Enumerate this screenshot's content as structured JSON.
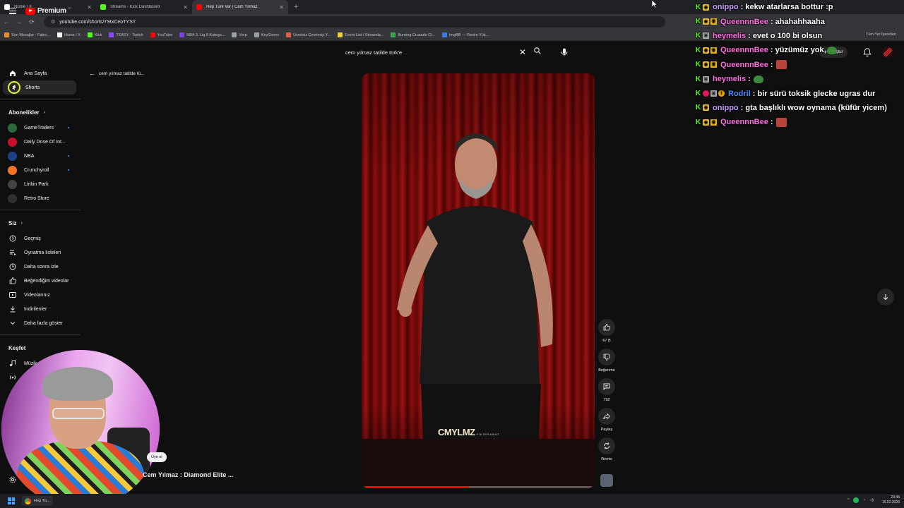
{
  "browser": {
    "tabs": [
      {
        "title": "Home / X",
        "color": "#ffffff"
      },
      {
        "title": "Streams - Kick Dashboard",
        "color": "#53fc18"
      },
      {
        "title": "Hep Türk Var | Cem Yılmaz",
        "color": "#ff0000"
      }
    ],
    "url": "youtube.com/shorts/7StxCeoTYSY",
    "bookmarks": [
      {
        "label": "Son Mesajlar - Fabci...",
        "color": "#f28b30"
      },
      {
        "label": "Home / X",
        "color": "#ffffff"
      },
      {
        "label": "Kick",
        "color": "#53fc18"
      },
      {
        "label": "TEASY - Twitch",
        "color": "#9146ff"
      },
      {
        "label": "YouTube",
        "color": "#ff0000"
      },
      {
        "label": "NBA 3. Lig 8 Katego...",
        "color": "#7b3fe4"
      },
      {
        "label": "Vorp",
        "color": "#9aa0a6"
      },
      {
        "label": "KeyGivers",
        "color": "#9aa0a6"
      },
      {
        "label": "Ücretsiz Çevrimiçi Y...",
        "color": "#e0604a"
      },
      {
        "label": "Event List / Streamla...",
        "color": "#f2d13a"
      },
      {
        "label": "Burning Crusade Cl...",
        "color": "#3da44b"
      },
      {
        "label": "ImgBB — Resim Yük...",
        "color": "#3d7be4"
      }
    ],
    "all_bookmarks": "Tüm Yer İşaretleri"
  },
  "youtube": {
    "logo_text": "Premium",
    "region": "TR",
    "search_value": "cem yılmaz tatilde türk'e",
    "create_label": "Oluştur",
    "back_text": "cem yılmaz tatilde tü...",
    "sidebar": {
      "top": [
        {
          "label": "Ana Sayfa",
          "icon": "home-icon"
        },
        {
          "label": "Shorts",
          "icon": "shorts-icon"
        }
      ],
      "subscriptions_title": "Abonelikler",
      "subscriptions": [
        {
          "label": "GameTrailers",
          "color": "#2b6a3a",
          "dot": true
        },
        {
          "label": "Daily Dose Of Int...",
          "color": "#c8102e",
          "dot": false
        },
        {
          "label": "NBA",
          "color": "#1d428a",
          "dot": true
        },
        {
          "label": "Crunchyroll",
          "color": "#f47521",
          "dot": true
        },
        {
          "label": "Linkin Park",
          "color": "#444444",
          "dot": false
        },
        {
          "label": "Retro Store",
          "color": "#2f2f2f",
          "dot": false
        }
      ],
      "you_title": "Siz",
      "you_items": [
        {
          "label": "Geçmiş",
          "icon": "history-icon"
        },
        {
          "label": "Oynatma listeleri",
          "icon": "playlist-icon"
        },
        {
          "label": "Daha sonra izle",
          "icon": "watch-later-icon"
        },
        {
          "label": "Beğendiğim videolar",
          "icon": "like-icon"
        },
        {
          "label": "Videolarınız",
          "icon": "your-videos-icon"
        },
        {
          "label": "İndirilenler",
          "icon": "download-icon"
        },
        {
          "label": "Daha fazla göster",
          "icon": "chevron-down-icon"
        }
      ],
      "explore_title": "Keşfet",
      "explore_items": [
        {
          "label": "Müzik",
          "icon": "music-icon"
        },
        {
          "label": "Canlı",
          "icon": "live-icon"
        }
      ]
    },
    "short": {
      "watermark": "CMYLMZ",
      "watermark_sub": "FİKİRSANAT",
      "title": "Cem Yılmaz : Diamond Elite ...",
      "join_label": "Üye ol",
      "progress": 0.46,
      "actions": [
        {
          "label": "67 B",
          "icon": "like-icon"
        },
        {
          "label": "Beğenme",
          "icon": "dislike-icon"
        },
        {
          "label": "792",
          "icon": "comment-icon"
        },
        {
          "label": "Paylaş",
          "icon": "share-icon"
        },
        {
          "label": "Remix",
          "icon": "remix-icon"
        }
      ]
    }
  },
  "chat": [
    {
      "user": "onippo",
      "color": "#c49bff",
      "badges": [
        "kick",
        "fox"
      ],
      "text": ": kekw atarlarsa bottur :p",
      "emote": ""
    },
    {
      "user": "QueennnBee",
      "color": "#ff6ee0",
      "badges": [
        "kick",
        "fox",
        "crown"
      ],
      "text": ": ahahahhaaha",
      "emote": ""
    },
    {
      "user": "heymelis",
      "color": "#ff6ee0",
      "badges": [
        "kick",
        "mod"
      ],
      "text": ": evet o 100 bi olsun",
      "emote": ""
    },
    {
      "user": "QueennnBee",
      "color": "#ff6ee0",
      "badges": [
        "kick",
        "fox",
        "crown"
      ],
      "text": ": yüzümüz yok",
      "emote": "green"
    },
    {
      "user": "QueennnBee",
      "color": "#ff6ee0",
      "badges": [
        "kick",
        "fox",
        "crown"
      ],
      "text": ":",
      "emote": "red"
    },
    {
      "user": "heymelis",
      "color": "#ff6ee0",
      "badges": [
        "kick",
        "mod"
      ],
      "text": ":",
      "emote": "green"
    },
    {
      "user": "Rodril",
      "color": "#4f8bff",
      "badges": [
        "kick",
        "heart",
        "mod",
        "warn"
      ],
      "text": ": bir sürü toksik glecke ugras dur",
      "emote": ""
    },
    {
      "user": "onippo",
      "color": "#c49bff",
      "badges": [
        "kick",
        "fox"
      ],
      "text": ": gta başlıklı wow oynama (küfür yicem)",
      "emote": ""
    },
    {
      "user": "QueennnBee",
      "color": "#ff6ee0",
      "badges": [
        "kick",
        "fox",
        "crown"
      ],
      "text": ":",
      "emote": "red"
    }
  ],
  "taskbar": {
    "app_label": "Hep Tü...",
    "time": "23:45",
    "date": "16.02.2026"
  }
}
